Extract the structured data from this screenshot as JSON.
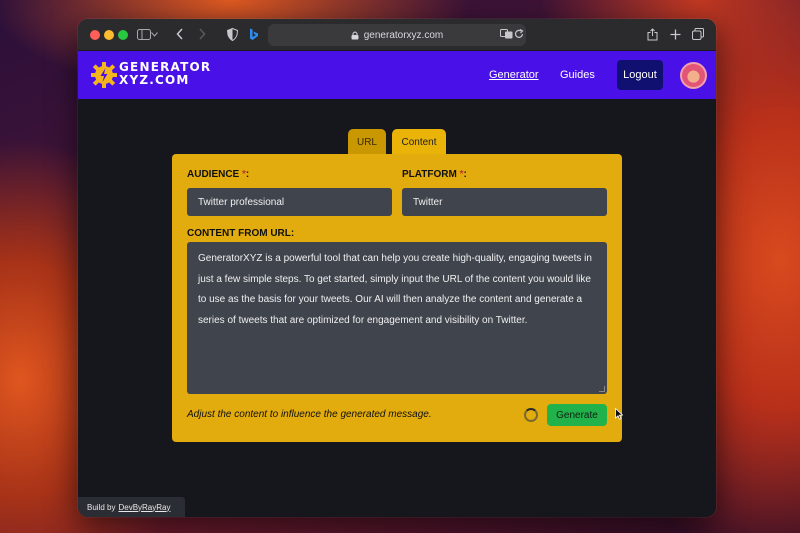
{
  "browser": {
    "url": "generatorxyz.com"
  },
  "navbar": {
    "logo_line1": "GENERATOR",
    "logo_line2": "XYZ.COM",
    "links": {
      "generator": "Generator",
      "guides": "Guides"
    },
    "logout_label": "Logout",
    "bg_color": "#4a10e8"
  },
  "tabs": [
    {
      "label": "URL",
      "active": false
    },
    {
      "label": "Content",
      "active": true
    }
  ],
  "form": {
    "audience_label": "AUDIENCE",
    "audience_value": "Twitter professional",
    "platform_label": "PLATFORM",
    "platform_value": "Twitter",
    "required_mark": "*",
    "label_suffix": ":",
    "content_label": "CONTENT FROM URL:",
    "content_value": "GeneratorXYZ is a powerful tool that can help you create high-quality, engaging tweets in just a few simple steps. To get started, simply input the URL of the content you would like to use as the basis for your tweets. Our AI will then analyze the content and generate a series of tweets that are optimized for engagement and visibility on Twitter.",
    "hint": "Adjust the content to influence the generated message.",
    "generate_label": "Generate",
    "panel_color": "#e2ac0e",
    "button_color": "#22b24c"
  },
  "footer": {
    "prefix": "Build by",
    "link": "DevByRayRay"
  }
}
